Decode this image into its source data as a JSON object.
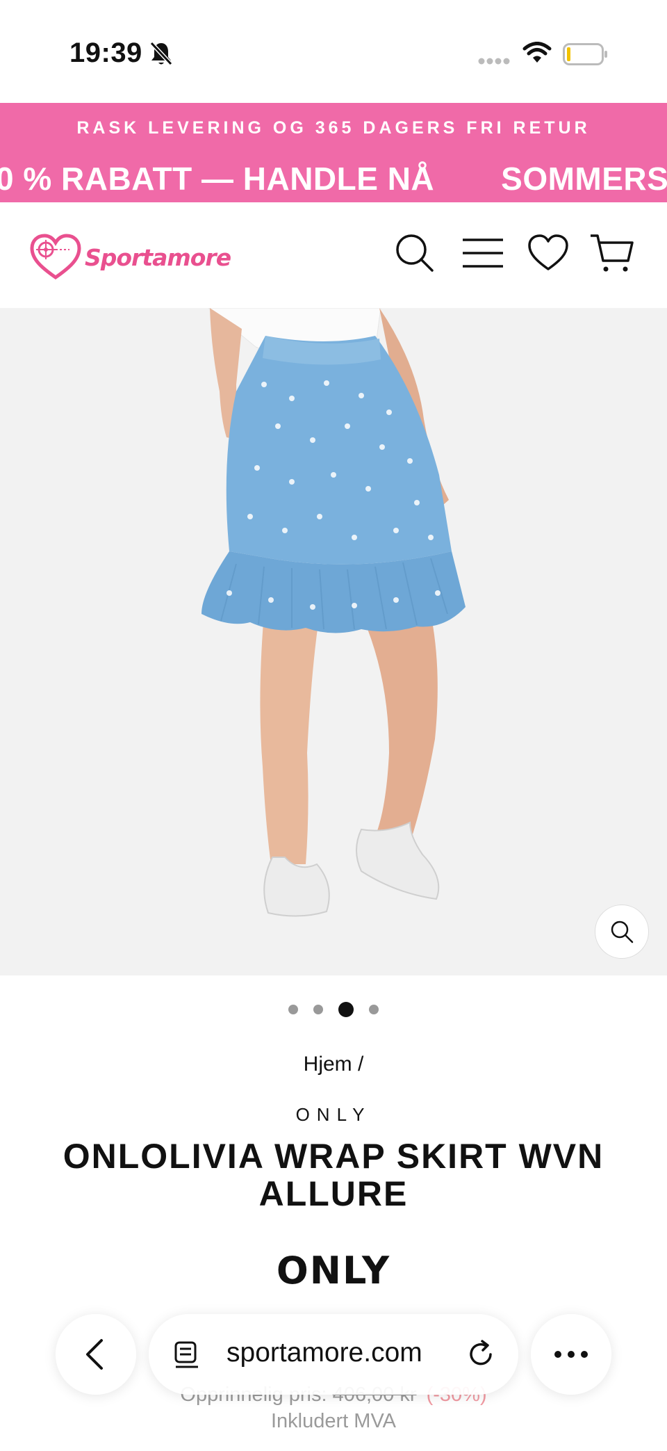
{
  "status_bar": {
    "time": "19:39"
  },
  "promo": {
    "line1": "RASK LEVERING OG 365 DAGERS FRI RETUR",
    "ticker_left": "0 % RABATT — HANDLE NÅ",
    "ticker_right": "SOMMERSA"
  },
  "header": {
    "logo_text": "Sportamore",
    "brand_color": "#e9508f"
  },
  "gallery": {
    "slide_count": 4,
    "active_slide": 3
  },
  "product": {
    "breadcrumb": "Hjem /",
    "brand_small": "ONLY",
    "title": "ONLOLIVIA WRAP SKIRT WVN ALLURE",
    "brand_logo": "ONLY",
    "original_price_label": "Opprinnelig pris:",
    "original_price": "406,00 kr",
    "discount": "(-30%)",
    "vat_label": "Inkludert MVA"
  },
  "browser": {
    "url": "sportamore.com"
  },
  "colors": {
    "promo_bg": "#f06aa8",
    "gallery_bg": "#f2f2f2"
  }
}
